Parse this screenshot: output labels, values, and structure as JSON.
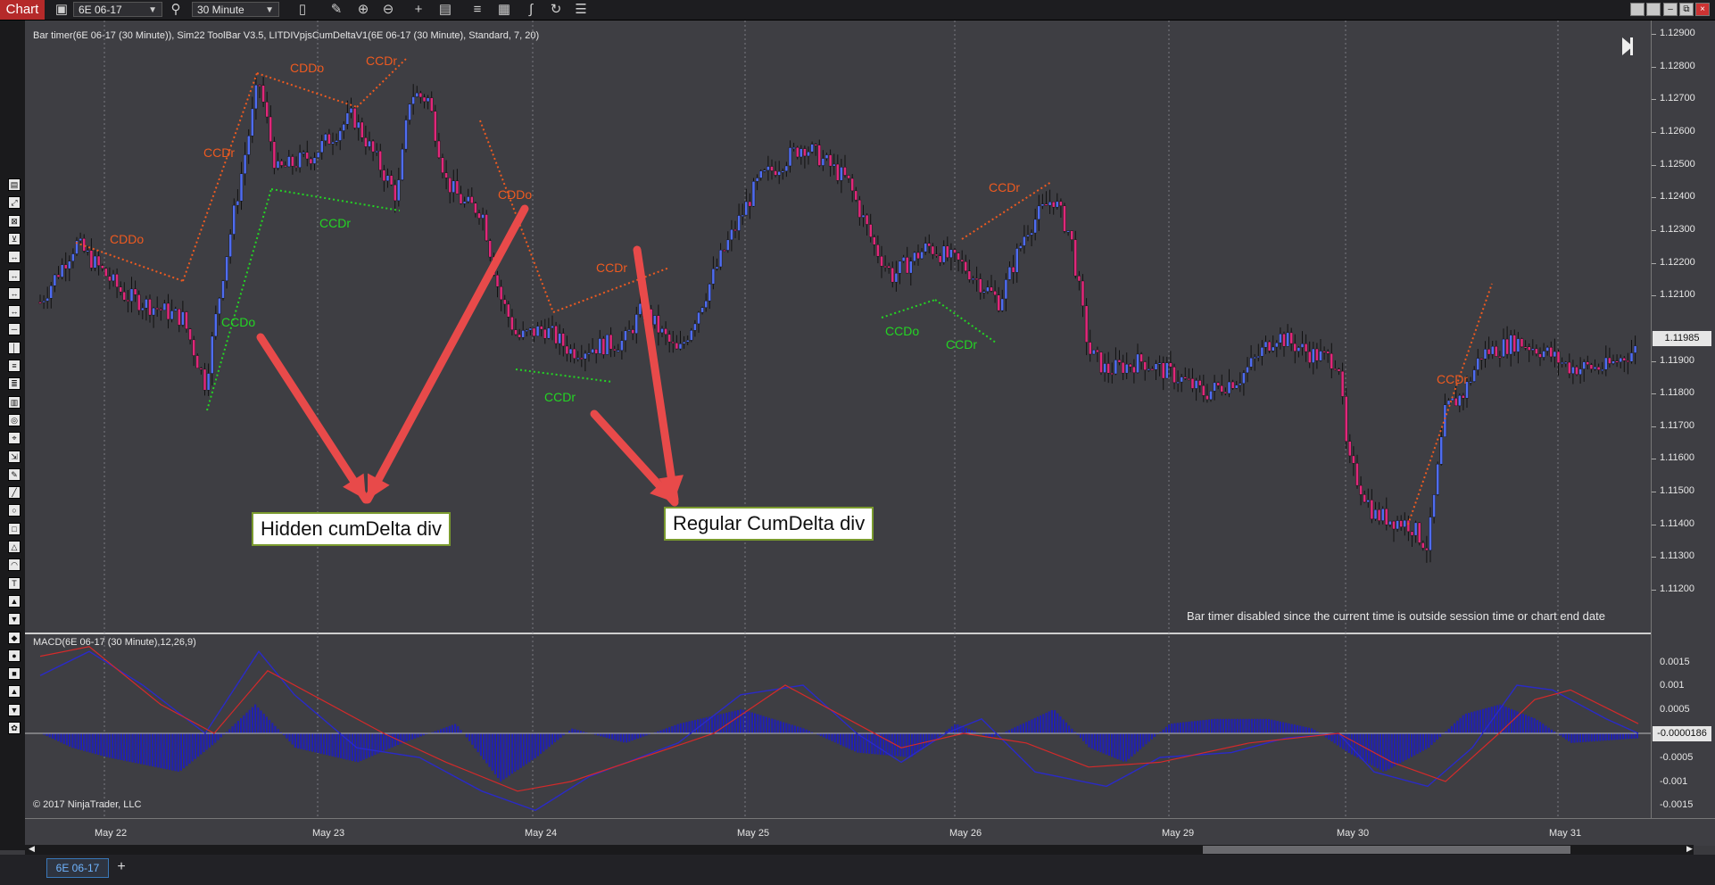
{
  "toolbar": {
    "chart_tab": "Chart",
    "instrument": "6E 06-17",
    "interval": "30 Minute",
    "icons": [
      "camera-icon",
      "search-icon",
      "bars-icon",
      "pencil-icon",
      "zoom-in-icon",
      "zoom-out-icon",
      "crosshair-icon",
      "properties-icon",
      "strategies-icon",
      "templates-icon",
      "indicators-icon",
      "refresh-icon",
      "list-icon"
    ]
  },
  "window_controls": [
    "restore-icon",
    "maximize-icon",
    "minimize-icon",
    "float-icon",
    "close-icon"
  ],
  "price_pane": {
    "indicator_line": "Bar timer(6E 06-17 (30 Minute)), Sim22 ToolBar V3.5, LITDIVpjsCumDeltaV1(6E 06-17 (30 Minute), Standard, 7, 20)",
    "bar_timer_message": "Bar timer disabled since the current time is outside session time or chart end date",
    "current_price": "1.11985",
    "price_ticks": [
      "1.12900",
      "1.12800",
      "1.12700",
      "1.12600",
      "1.12500",
      "1.12400",
      "1.12300",
      "1.12200",
      "1.12100",
      "1.11900",
      "1.11800",
      "1.11700",
      "1.11600",
      "1.11500",
      "1.11400",
      "1.11300",
      "1.11200"
    ],
    "labels": [
      {
        "text": "CDDo",
        "color": "orange"
      },
      {
        "text": "CCDr",
        "color": "orange"
      },
      {
        "text": "CDDo",
        "color": "orange"
      },
      {
        "text": "CCDr",
        "color": "orange"
      },
      {
        "text": "CDDo",
        "color": "orange"
      },
      {
        "text": "CCDr",
        "color": "orange"
      },
      {
        "text": "CCDr",
        "color": "orange"
      },
      {
        "text": "CCDr",
        "color": "orange"
      },
      {
        "text": "CCDr",
        "color": "green"
      },
      {
        "text": "CCDo",
        "color": "green"
      },
      {
        "text": "CCDr",
        "color": "green"
      },
      {
        "text": "CCDo",
        "color": "green"
      },
      {
        "text": "CCDr",
        "color": "green"
      }
    ],
    "callouts": {
      "hidden": "Hidden cumDelta div",
      "regular": "Regular CumDelta div"
    }
  },
  "macd_pane": {
    "title": "MACD(6E 06-17 (30 Minute),12,26,9)",
    "copyright": "© 2017 NinjaTrader, LLC",
    "current_value": "-0.0000186",
    "ticks": [
      "0.0015",
      "0.001",
      "0.0005",
      "-0.0005",
      "-0.001",
      "-0.0015"
    ]
  },
  "x_axis": {
    "dates": [
      "May 22",
      "May 23",
      "May 24",
      "May 25",
      "May 26",
      "May 29",
      "May 30",
      "May 31"
    ]
  },
  "bottom": {
    "sheet_tab": "6E 06-17",
    "add_tab": "+"
  },
  "colors": {
    "bg": "#3e3e43",
    "orange": "#ee5a20",
    "green": "#24d424",
    "bull": "#4f6cf0",
    "bear": "#e0287a"
  }
}
